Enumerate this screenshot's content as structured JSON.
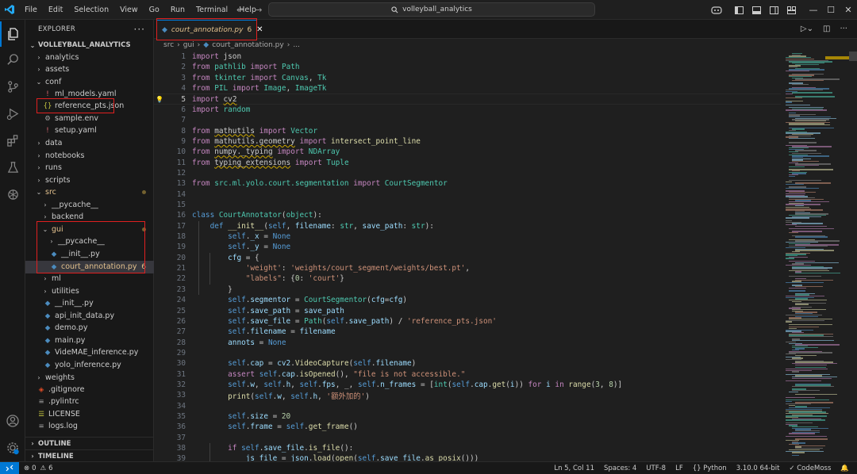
{
  "menu": [
    "File",
    "Edit",
    "Selection",
    "View",
    "Go",
    "Run",
    "Terminal",
    "Help"
  ],
  "search": {
    "text": "volleyball_analytics"
  },
  "explorer": {
    "title": "EXPLORER",
    "project": "VOLLEYBALL_ANALYTICS",
    "items": [
      {
        "label": "analytics",
        "kind": "folder",
        "depth": 1,
        "open": false
      },
      {
        "label": "assets",
        "kind": "folder",
        "depth": 1,
        "open": false
      },
      {
        "label": "conf",
        "kind": "folder",
        "depth": 1,
        "open": true
      },
      {
        "label": "ml_models.yaml",
        "kind": "yaml",
        "depth": 2
      },
      {
        "label": "reference_pts.json",
        "kind": "json",
        "depth": 2
      },
      {
        "label": "sample.env",
        "kind": "env",
        "depth": 2
      },
      {
        "label": "setup.yaml",
        "kind": "yaml",
        "depth": 2
      },
      {
        "label": "data",
        "kind": "folder",
        "depth": 1,
        "open": false
      },
      {
        "label": "notebooks",
        "kind": "folder",
        "depth": 1,
        "open": false
      },
      {
        "label": "runs",
        "kind": "folder",
        "depth": 1,
        "open": false
      },
      {
        "label": "scripts",
        "kind": "folder",
        "depth": 1,
        "open": false
      },
      {
        "label": "src",
        "kind": "folder",
        "depth": 1,
        "open": true,
        "modified": true
      },
      {
        "label": "__pycache__",
        "kind": "folder",
        "depth": 2,
        "open": false
      },
      {
        "label": "backend",
        "kind": "folder",
        "depth": 2,
        "open": false
      },
      {
        "label": "gui",
        "kind": "folder",
        "depth": 2,
        "open": true,
        "modified": true
      },
      {
        "label": "__pycache__",
        "kind": "folder",
        "depth": 3,
        "open": false
      },
      {
        "label": "__init__.py",
        "kind": "py",
        "depth": 3
      },
      {
        "label": "court_annotation.py",
        "kind": "py",
        "depth": 3,
        "modified": true,
        "selected": true,
        "problems": "6"
      },
      {
        "label": "ml",
        "kind": "folder",
        "depth": 2,
        "open": false
      },
      {
        "label": "utilities",
        "kind": "folder",
        "depth": 2,
        "open": false
      },
      {
        "label": "__init__.py",
        "kind": "py",
        "depth": 2
      },
      {
        "label": "api_init_data.py",
        "kind": "py",
        "depth": 2
      },
      {
        "label": "demo.py",
        "kind": "py",
        "depth": 2
      },
      {
        "label": "main.py",
        "kind": "py",
        "depth": 2
      },
      {
        "label": "VideMAE_inference.py",
        "kind": "py",
        "depth": 2
      },
      {
        "label": "yolo_inference.py",
        "kind": "py",
        "depth": 2
      },
      {
        "label": "weights",
        "kind": "folder",
        "depth": 1,
        "open": false
      },
      {
        "label": ".gitignore",
        "kind": "git",
        "depth": 1
      },
      {
        "label": ".pylintrc",
        "kind": "rc",
        "depth": 1
      },
      {
        "label": "LICENSE",
        "kind": "license",
        "depth": 1
      },
      {
        "label": "logs.log",
        "kind": "log",
        "depth": 1
      }
    ],
    "outline": "OUTLINE",
    "timeline": "TIMELINE"
  },
  "tab": {
    "label": "court_annotation.py",
    "problems": "6"
  },
  "breadcrumb": [
    "src",
    "gui",
    "court_annotation.py",
    "..."
  ],
  "code_lines": [
    [
      [
        "kw",
        "import"
      ],
      [
        "t",
        " json"
      ]
    ],
    [
      [
        "kw",
        "from"
      ],
      [
        "t",
        " "
      ],
      [
        "cls",
        "pathlib"
      ],
      [
        "t",
        " "
      ],
      [
        "kw",
        "import"
      ],
      [
        "t",
        " "
      ],
      [
        "cls",
        "Path"
      ]
    ],
    [
      [
        "kw",
        "from"
      ],
      [
        "t",
        " "
      ],
      [
        "cls",
        "tkinter"
      ],
      [
        "t",
        " "
      ],
      [
        "kw",
        "import"
      ],
      [
        "t",
        " "
      ],
      [
        "cls",
        "Canvas"
      ],
      [
        "t",
        ", "
      ],
      [
        "cls",
        "Tk"
      ]
    ],
    [
      [
        "kw",
        "from"
      ],
      [
        "t",
        " "
      ],
      [
        "cls",
        "PIL"
      ],
      [
        "t",
        " "
      ],
      [
        "kw",
        "import"
      ],
      [
        "t",
        " "
      ],
      [
        "cls",
        "Image"
      ],
      [
        "t",
        ", "
      ],
      [
        "cls",
        "ImageTk"
      ]
    ],
    [
      [
        "kw",
        "import"
      ],
      [
        "t",
        " "
      ],
      [
        "sq",
        "cv2"
      ]
    ],
    [
      [
        "kw",
        "import"
      ],
      [
        "t",
        " "
      ],
      [
        "cls",
        "random"
      ]
    ],
    [],
    [
      [
        "kw",
        "from"
      ],
      [
        "t",
        " "
      ],
      [
        "sq",
        "mathutils"
      ],
      [
        "t",
        " "
      ],
      [
        "kw",
        "import"
      ],
      [
        "t",
        " "
      ],
      [
        "cls",
        "Vector"
      ]
    ],
    [
      [
        "kw",
        "from"
      ],
      [
        "t",
        " "
      ],
      [
        "sq",
        "mathutils.geometry"
      ],
      [
        "t",
        " "
      ],
      [
        "kw",
        "import"
      ],
      [
        "t",
        " "
      ],
      [
        "fn",
        "intersect_point_line"
      ]
    ],
    [
      [
        "kw",
        "from"
      ],
      [
        "t",
        " "
      ],
      [
        "sq",
        "numpy._typing"
      ],
      [
        "t",
        " "
      ],
      [
        "kw",
        "import"
      ],
      [
        "t",
        " "
      ],
      [
        "cls",
        "NDArray"
      ]
    ],
    [
      [
        "kw",
        "from"
      ],
      [
        "t",
        " "
      ],
      [
        "sq",
        "typing_extensions"
      ],
      [
        "t",
        " "
      ],
      [
        "kw",
        "import"
      ],
      [
        "t",
        " "
      ],
      [
        "cls",
        "Tuple"
      ]
    ],
    [],
    [
      [
        "kw",
        "from"
      ],
      [
        "t",
        " "
      ],
      [
        "cls",
        "src.ml.yolo.court.segmentation"
      ],
      [
        "t",
        " "
      ],
      [
        "kw",
        "import"
      ],
      [
        "t",
        " "
      ],
      [
        "cls",
        "CourtSegmentor"
      ]
    ],
    [],
    [],
    [
      [
        "kb",
        "class"
      ],
      [
        "t",
        " "
      ],
      [
        "cls",
        "CourtAnnotator"
      ],
      [
        "t",
        "("
      ],
      [
        "cls",
        "object"
      ],
      [
        "t",
        "):"
      ]
    ],
    [
      [
        "t",
        "    "
      ],
      [
        "kb",
        "def"
      ],
      [
        "t",
        " "
      ],
      [
        "fn",
        "__init__"
      ],
      [
        "t",
        "("
      ],
      [
        "self",
        "self"
      ],
      [
        "t",
        ", "
      ],
      [
        "var",
        "filename"
      ],
      [
        "t",
        ": "
      ],
      [
        "cls",
        "str"
      ],
      [
        "t",
        ", "
      ],
      [
        "var",
        "save_path"
      ],
      [
        "t",
        ": "
      ],
      [
        "cls",
        "str"
      ],
      [
        "t",
        "):"
      ]
    ],
    [
      [
        "t",
        "        "
      ],
      [
        "self",
        "self"
      ],
      [
        "t",
        "."
      ],
      [
        "var",
        "_x"
      ],
      [
        "t",
        " = "
      ],
      [
        "kb",
        "None"
      ]
    ],
    [
      [
        "t",
        "        "
      ],
      [
        "self",
        "self"
      ],
      [
        "t",
        "."
      ],
      [
        "var",
        "_y"
      ],
      [
        "t",
        " = "
      ],
      [
        "kb",
        "None"
      ]
    ],
    [
      [
        "t",
        "        "
      ],
      [
        "var",
        "cfg"
      ],
      [
        "t",
        " = {"
      ]
    ],
    [
      [
        "t",
        "            "
      ],
      [
        "str",
        "'weight'"
      ],
      [
        "t",
        ": "
      ],
      [
        "str",
        "'weights/court_segment/weights/best.pt'"
      ],
      [
        "t",
        ","
      ]
    ],
    [
      [
        "t",
        "            "
      ],
      [
        "str",
        "\"labels\""
      ],
      [
        "t",
        ": {"
      ],
      [
        "num",
        "0"
      ],
      [
        "t",
        ": "
      ],
      [
        "str",
        "'court'"
      ],
      [
        "t",
        "}"
      ]
    ],
    [
      [
        "t",
        "        }"
      ]
    ],
    [
      [
        "t",
        "        "
      ],
      [
        "self",
        "self"
      ],
      [
        "t",
        "."
      ],
      [
        "var",
        "segmentor"
      ],
      [
        "t",
        " = "
      ],
      [
        "cls",
        "CourtSegmentor"
      ],
      [
        "t",
        "("
      ],
      [
        "var",
        "cfg"
      ],
      [
        "t",
        "="
      ],
      [
        "var",
        "cfg"
      ],
      [
        "t",
        ")"
      ]
    ],
    [
      [
        "t",
        "        "
      ],
      [
        "self",
        "self"
      ],
      [
        "t",
        "."
      ],
      [
        "var",
        "save_path"
      ],
      [
        "t",
        " = "
      ],
      [
        "var",
        "save_path"
      ]
    ],
    [
      [
        "t",
        "        "
      ],
      [
        "self",
        "self"
      ],
      [
        "t",
        "."
      ],
      [
        "var",
        "save_file"
      ],
      [
        "t",
        " = "
      ],
      [
        "cls",
        "Path"
      ],
      [
        "t",
        "("
      ],
      [
        "self",
        "self"
      ],
      [
        "t",
        "."
      ],
      [
        "var",
        "save_path"
      ],
      [
        "t",
        ") / "
      ],
      [
        "str",
        "'reference_pts.json'"
      ]
    ],
    [
      [
        "t",
        "        "
      ],
      [
        "self",
        "self"
      ],
      [
        "t",
        "."
      ],
      [
        "var",
        "filename"
      ],
      [
        "t",
        " = "
      ],
      [
        "var",
        "filename"
      ]
    ],
    [
      [
        "t",
        "        "
      ],
      [
        "var",
        "annots"
      ],
      [
        "t",
        " = "
      ],
      [
        "kb",
        "None"
      ]
    ],
    [],
    [
      [
        "t",
        "        "
      ],
      [
        "self",
        "self"
      ],
      [
        "t",
        "."
      ],
      [
        "var",
        "cap"
      ],
      [
        "t",
        " = "
      ],
      [
        "var",
        "cv2"
      ],
      [
        "t",
        "."
      ],
      [
        "fn",
        "VideoCapture"
      ],
      [
        "t",
        "("
      ],
      [
        "self",
        "self"
      ],
      [
        "t",
        "."
      ],
      [
        "var",
        "filename"
      ],
      [
        "t",
        ")"
      ]
    ],
    [
      [
        "t",
        "        "
      ],
      [
        "kw",
        "assert"
      ],
      [
        "t",
        " "
      ],
      [
        "self",
        "self"
      ],
      [
        "t",
        "."
      ],
      [
        "var",
        "cap"
      ],
      [
        "t",
        "."
      ],
      [
        "fn",
        "isOpened"
      ],
      [
        "t",
        "(), "
      ],
      [
        "str",
        "\"file is not accessible.\""
      ]
    ],
    [
      [
        "t",
        "        "
      ],
      [
        "self",
        "self"
      ],
      [
        "t",
        "."
      ],
      [
        "var",
        "w"
      ],
      [
        "t",
        ", "
      ],
      [
        "self",
        "self"
      ],
      [
        "t",
        "."
      ],
      [
        "var",
        "h"
      ],
      [
        "t",
        ", "
      ],
      [
        "self",
        "self"
      ],
      [
        "t",
        "."
      ],
      [
        "var",
        "fps"
      ],
      [
        "t",
        ", _, "
      ],
      [
        "self",
        "self"
      ],
      [
        "t",
        "."
      ],
      [
        "var",
        "n_frames"
      ],
      [
        "t",
        " = ["
      ],
      [
        "cls",
        "int"
      ],
      [
        "t",
        "("
      ],
      [
        "self",
        "self"
      ],
      [
        "t",
        "."
      ],
      [
        "var",
        "cap"
      ],
      [
        "t",
        "."
      ],
      [
        "fn",
        "get"
      ],
      [
        "t",
        "("
      ],
      [
        "var",
        "i"
      ],
      [
        "t",
        ")) "
      ],
      [
        "kw",
        "for"
      ],
      [
        "t",
        " "
      ],
      [
        "var",
        "i"
      ],
      [
        "t",
        " "
      ],
      [
        "kw",
        "in"
      ],
      [
        "t",
        " "
      ],
      [
        "fn",
        "range"
      ],
      [
        "t",
        "("
      ],
      [
        "num",
        "3"
      ],
      [
        "t",
        ", "
      ],
      [
        "num",
        "8"
      ],
      [
        "t",
        ")]"
      ]
    ],
    [
      [
        "t",
        "        "
      ],
      [
        "fn",
        "print"
      ],
      [
        "t",
        "("
      ],
      [
        "self",
        "self"
      ],
      [
        "t",
        "."
      ],
      [
        "var",
        "w"
      ],
      [
        "t",
        ", "
      ],
      [
        "self",
        "self"
      ],
      [
        "t",
        "."
      ],
      [
        "var",
        "h"
      ],
      [
        "t",
        ", "
      ],
      [
        "str",
        "'额外加的'"
      ],
      [
        "t",
        ")"
      ]
    ],
    [],
    [
      [
        "t",
        "        "
      ],
      [
        "self",
        "self"
      ],
      [
        "t",
        "."
      ],
      [
        "var",
        "size"
      ],
      [
        "t",
        " = "
      ],
      [
        "num",
        "20"
      ]
    ],
    [
      [
        "t",
        "        "
      ],
      [
        "self",
        "self"
      ],
      [
        "t",
        "."
      ],
      [
        "var",
        "frame"
      ],
      [
        "t",
        " = "
      ],
      [
        "self",
        "self"
      ],
      [
        "t",
        "."
      ],
      [
        "fn",
        "get_frame"
      ],
      [
        "t",
        "()"
      ]
    ],
    [],
    [
      [
        "t",
        "        "
      ],
      [
        "kw",
        "if"
      ],
      [
        "t",
        " "
      ],
      [
        "self",
        "self"
      ],
      [
        "t",
        "."
      ],
      [
        "var",
        "save_file"
      ],
      [
        "t",
        "."
      ],
      [
        "fn",
        "is_file"
      ],
      [
        "t",
        "():"
      ]
    ],
    [
      [
        "t",
        "            "
      ],
      [
        "var",
        "js_file"
      ],
      [
        "t",
        " = "
      ],
      [
        "var",
        "json"
      ],
      [
        "t",
        "."
      ],
      [
        "fn",
        "load"
      ],
      [
        "t",
        "("
      ],
      [
        "fn",
        "open"
      ],
      [
        "t",
        "("
      ],
      [
        "self",
        "self"
      ],
      [
        "t",
        "."
      ],
      [
        "var",
        "save_file"
      ],
      [
        "t",
        "."
      ],
      [
        "fn",
        "as_posix"
      ],
      [
        "t",
        "()))"
      ]
    ]
  ],
  "current_line": 5,
  "status": {
    "errors": "0",
    "warnings": "6",
    "position": "Ln 5, Col 11",
    "spaces": "Spaces: 4",
    "encoding": "UTF-8",
    "eol": "LF",
    "language": "Python",
    "interpreter": "3.10.0 64-bit",
    "codemoss": "CodeMoss"
  },
  "colors": {
    "accent": "#0078d4",
    "modified": "#e2c08d",
    "annotation": "#e02020"
  },
  "icons": [
    "vscode-logo",
    "search-icon",
    "explorer-icon",
    "source-control-icon",
    "run-debug-icon",
    "extensions-icon",
    "testing-icon",
    "chatgpt-icon",
    "account-icon",
    "settings-gear-icon",
    "python-file-icon",
    "json-file-icon",
    "yaml-file-icon",
    "lightbulb-icon",
    "run-icon",
    "split-editor-icon",
    "more-icon"
  ]
}
